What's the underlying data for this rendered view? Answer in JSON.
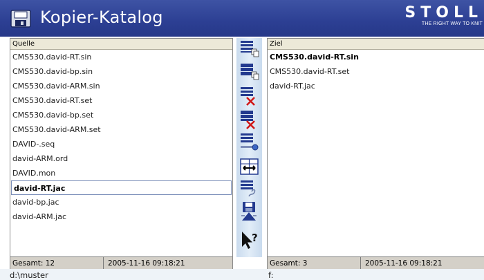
{
  "app": {
    "title": "Kopier-Katalog",
    "brand_name": "STOLL",
    "brand_tagline": "THE RIGHT WAY TO KNIT"
  },
  "source": {
    "header": "Quelle",
    "files": [
      "CMS530.david-RT.sin",
      "CMS530.david-bp.sin",
      "CMS530.david-ARM.sin",
      "CMS530.david-RT.set",
      "CMS530.david-bp.set",
      "CMS530.david-ARM.set",
      "DAVID-.seq",
      "david-ARM.ord",
      "DAVID.mon",
      "david-RT.jac",
      "david-bp.jac",
      "david-ARM.jac"
    ],
    "selected_index": 9,
    "count_label": "Gesamt:  12",
    "date": "2005-11-16 09:18:21",
    "path": "d:\\muster"
  },
  "target": {
    "header": "Ziel",
    "files": [
      "CMS530.david-RT.sin",
      "CMS530.david-RT.set",
      "david-RT.jac"
    ],
    "bold_index": 0,
    "count_label": "Gesamt:  3",
    "date": "2005-11-16 09:18:21",
    "path": "f:"
  },
  "toolbar": {
    "icons": [
      "copy-selected-icon",
      "copy-all-icon",
      "delete-selected-icon",
      "delete-all-icon",
      "key-icon",
      "swap-icon",
      "link-icon",
      "save-icon",
      "help-icon"
    ]
  },
  "colors": {
    "title_bar": "#2c3f93",
    "icon_blue": "#233a8f",
    "delete_red": "#d01818"
  }
}
